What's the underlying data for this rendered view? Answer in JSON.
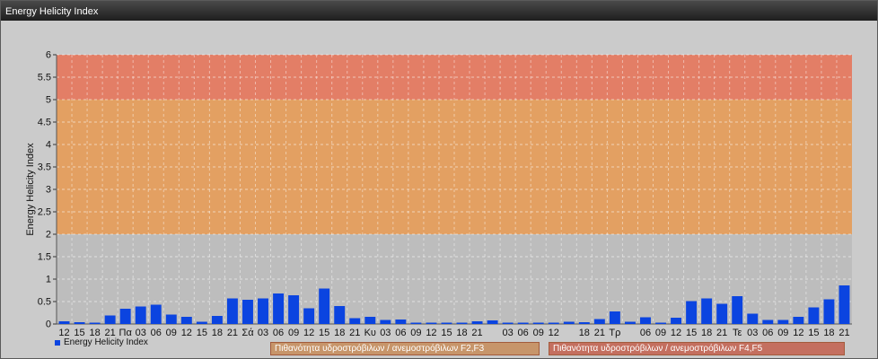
{
  "window": {
    "title": "Energy Helicity Index"
  },
  "chart_data": {
    "type": "bar",
    "ylabel": "Energy Helicity Index",
    "xlabel": "",
    "ylim": [
      0,
      6
    ],
    "yticks": [
      "0",
      "0.5",
      "1",
      "1.5",
      "2",
      "2.5",
      "3",
      "3.5",
      "4",
      "4.5",
      "5",
      "5.5",
      "6"
    ],
    "categories": [
      "12",
      "15",
      "18",
      "21",
      "Πα",
      "03",
      "06",
      "09",
      "12",
      "15",
      "18",
      "21",
      "Σά",
      "03",
      "06",
      "09",
      "12",
      "15",
      "18",
      "21",
      "Κυ",
      "03",
      "06",
      "09",
      "12",
      "15",
      "18",
      "21",
      "",
      "03",
      "06",
      "09",
      "12",
      "",
      "18",
      "21",
      "Τρ",
      "",
      "06",
      "09",
      "12",
      "15",
      "18",
      "21",
      "Τε",
      "03",
      "06",
      "09",
      "12",
      "15",
      "18",
      "21"
    ],
    "series": [
      {
        "name": "Energy Helicity Index",
        "color": "#0b44e0",
        "values": [
          0.06,
          0.04,
          0.03,
          0.19,
          0.34,
          0.39,
          0.43,
          0.21,
          0.16,
          0.05,
          0.18,
          0.57,
          0.54,
          0.57,
          0.68,
          0.64,
          0.35,
          0.79,
          0.4,
          0.13,
          0.16,
          0.09,
          0.1,
          0.03,
          0.03,
          0.03,
          0.03,
          0.06,
          0.08,
          0.03,
          0.03,
          0.03,
          0.03,
          0.05,
          0.04,
          0.11,
          0.28,
          0.05,
          0.15,
          0.03,
          0.14,
          0.51,
          0.57,
          0.45,
          0.62,
          0.23,
          0.09,
          0.09,
          0.16,
          0.37,
          0.55,
          0.86
        ]
      }
    ],
    "bands": [
      {
        "from": 2,
        "to": 5,
        "color": "#e3a062",
        "label": "Πιθανότητα υδροστρόβιλων / ανεμοστρόβιλων F2,F3"
      },
      {
        "from": 5,
        "to": 6,
        "color": "#e37e66",
        "label": "Πιθανότητα υδροστρόβιλων / ανεμοστρόβιλων F4,F5"
      }
    ],
    "grid": true,
    "legend": "bottom-left"
  }
}
